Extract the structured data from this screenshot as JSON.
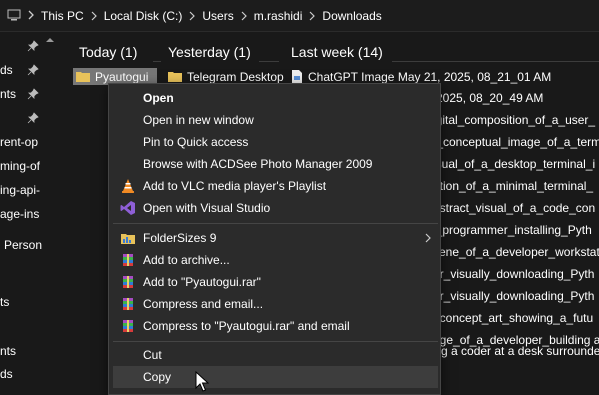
{
  "address_bar": {
    "crumbs": [
      "This PC",
      "Local Disk (C:)",
      "Users",
      "m.rashidi",
      "Downloads"
    ]
  },
  "nav_pane": {
    "items": [
      {
        "text": "ds",
        "pinned": true
      },
      {
        "text": "nts",
        "pinned": true
      },
      {
        "text": "",
        "pinned": true
      },
      {
        "text": "rent-op",
        "pinned": false
      },
      {
        "text": "ming-of",
        "pinned": false
      },
      {
        "text": "ing-api-",
        "pinned": false
      },
      {
        "text": "age-ins",
        "pinned": false
      },
      {
        "text": "Person",
        "pinned": false
      },
      {
        "text": "ts",
        "pinned": false
      },
      {
        "text": "nts",
        "pinned": false
      },
      {
        "text": "ds",
        "pinned": false
      }
    ]
  },
  "groups": {
    "today": "Today (1)",
    "yesterday": "Yesterday (1)",
    "last_week": "Last week (14)"
  },
  "files": {
    "today_item": "Pyautogui",
    "yesterday_item": "Telegram Desktop",
    "last_week_first": "ChatGPT Image May 21, 2025, 08_21_01 AM",
    "last_week_second_tail": "2025, 08_20_49 AM",
    "right_column": [
      "igital_composition_of_a_user_",
      "t_conceptual_image_of_a_term",
      "isual_of_a_desktop_terminal_i",
      "ation_of_a_minimal_terminal_",
      "bstract_visual_of_a_code_con",
      "l_programmer_installing_Pyth",
      "cene_of_a_developer_workstat",
      "er_visually_downloading_Pyth",
      "er_visually_downloading_Pyth",
      "_concept_art_showing_a_futu",
      "age_of_a_developer_building ar",
      "g a coder at a desk surrounde"
    ]
  },
  "context_menu": {
    "open": "Open",
    "open_new_window": "Open in new window",
    "pin_quick_access": "Pin to Quick access",
    "browse_acdsee": "Browse with ACDSee Photo Manager 2009",
    "vlc_playlist": "Add to VLC media player's Playlist",
    "open_vs": "Open with Visual Studio",
    "folder_sizes": "FolderSizes 9",
    "add_archive": "Add to archive...",
    "add_rar": "Add to \"Pyautogui.rar\"",
    "compress_email": "Compress and email...",
    "compress_rar_email": "Compress to \"Pyautogui.rar\" and email",
    "cut": "Cut",
    "copy": "Copy"
  },
  "colors": {
    "background": "#191919",
    "menu_background": "#2b2b2b",
    "menu_hover": "#3d3d3d",
    "selection": "#777777",
    "folder_yellow": "#e8c25a"
  }
}
